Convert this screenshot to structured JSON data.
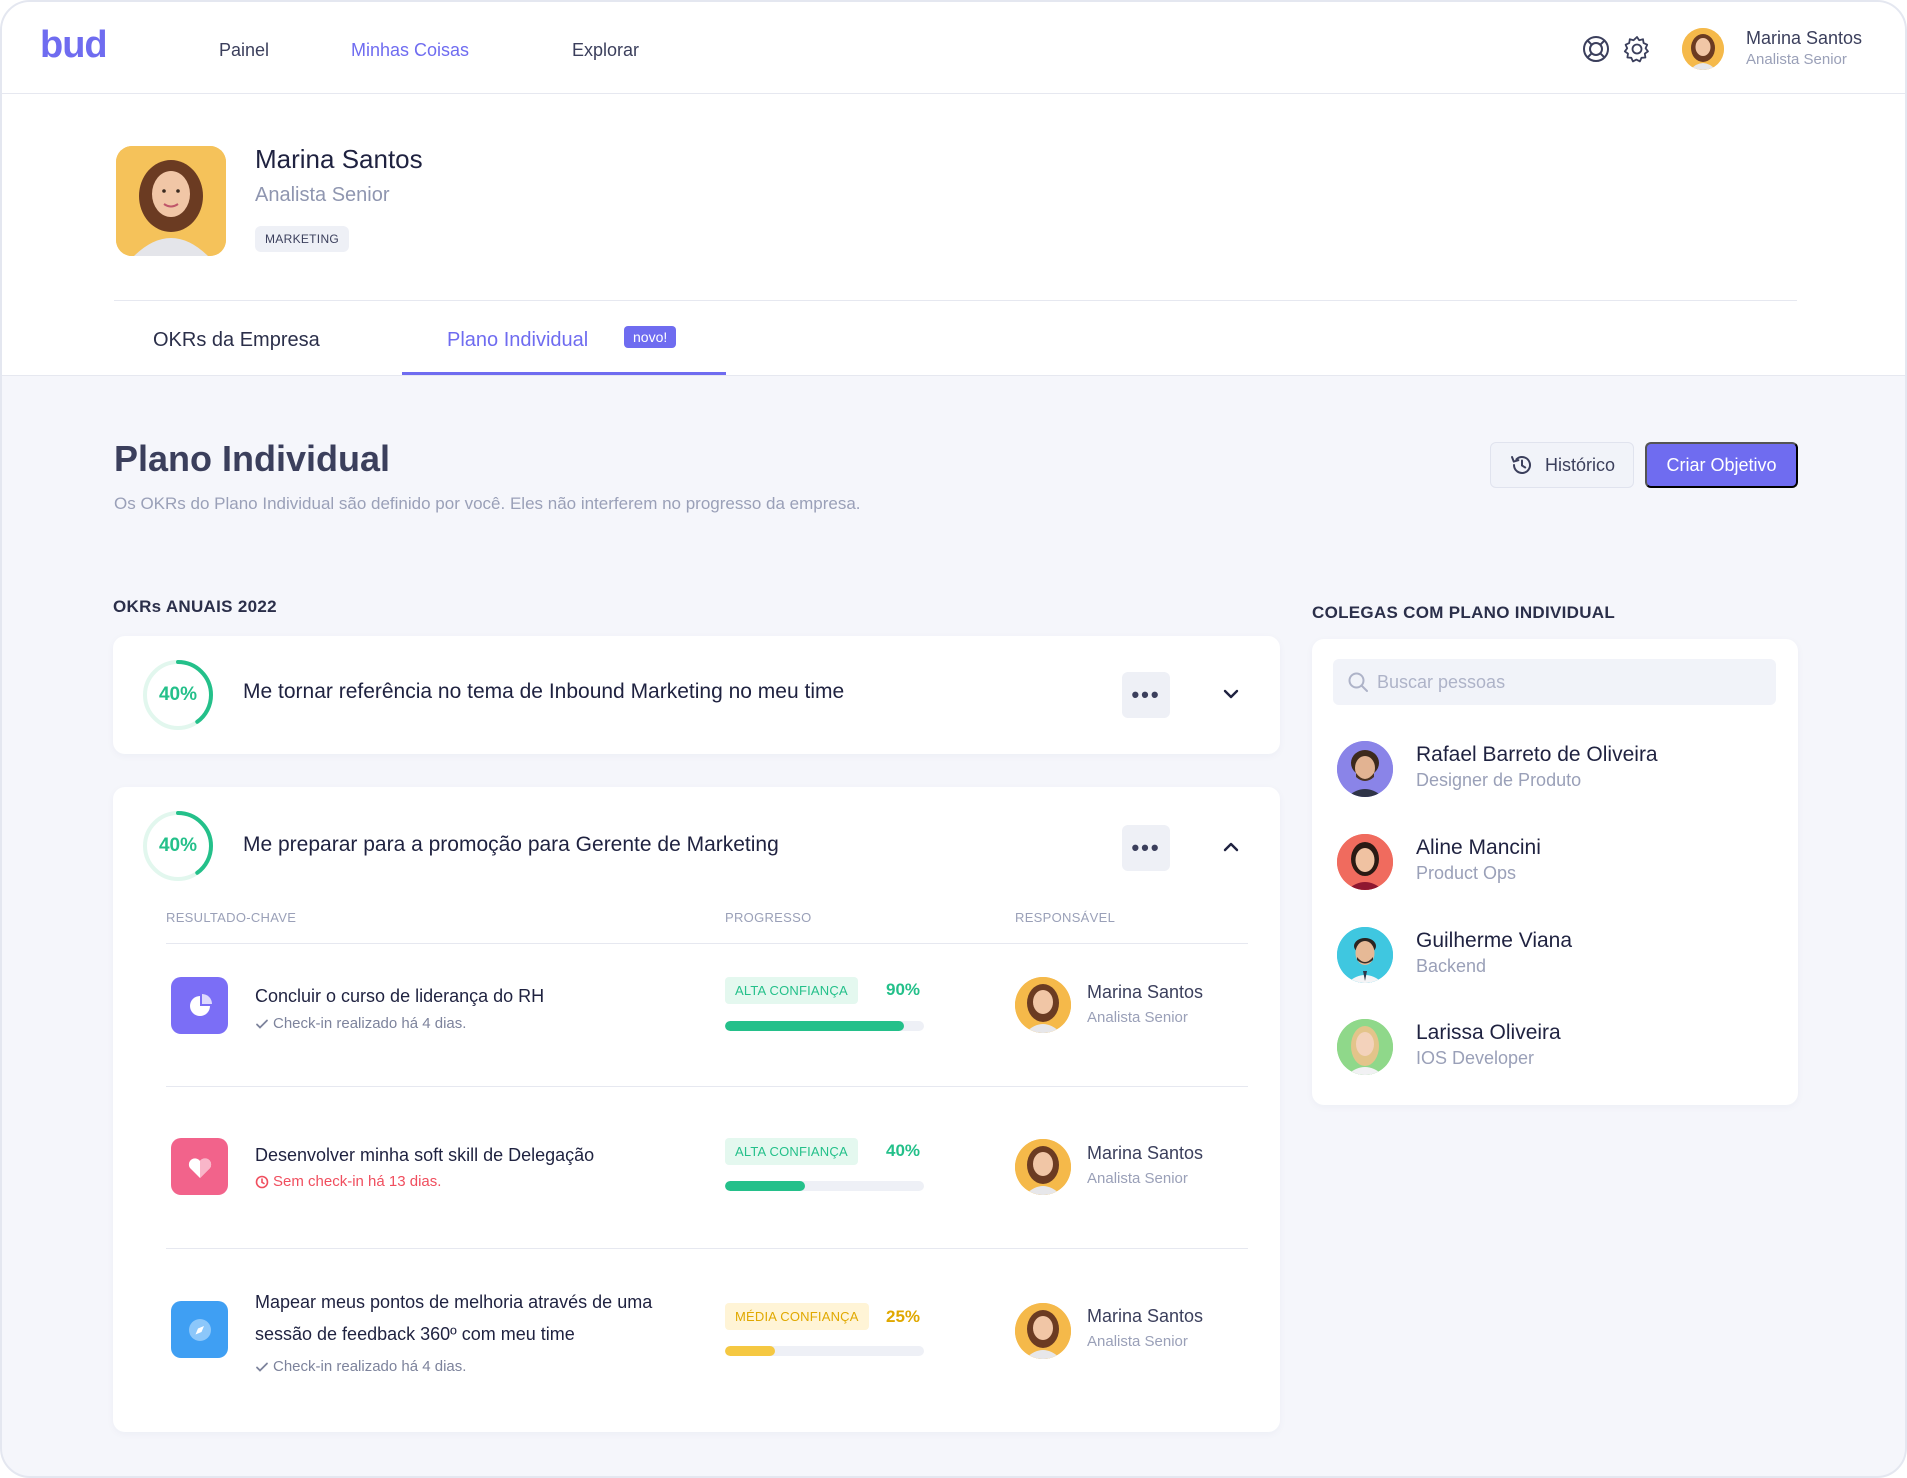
{
  "nav": {
    "logo": "bud",
    "links": [
      {
        "label": "Painel",
        "active": false
      },
      {
        "label": "Minhas Coisas",
        "active": true
      },
      {
        "label": "Explorar",
        "active": false
      }
    ],
    "icons": [
      "help-icon",
      "settings-icon"
    ],
    "user": {
      "name": "Marina Santos",
      "role": "Analista Senior"
    }
  },
  "profile": {
    "name": "Marina Santos",
    "role": "Analista Senior",
    "team_tag": "MARKETING",
    "tabs": [
      {
        "label": "OKRs da Empresa",
        "active": false
      },
      {
        "label": "Plano Individual",
        "active": true,
        "badge": "novo!"
      }
    ]
  },
  "page": {
    "title": "Plano Individual",
    "subtitle": "Os OKRs do Plano Individual são definido por você. Eles não interferem no progresso da empresa.",
    "history_button": "Histórico",
    "create_button": "Criar Objetivo"
  },
  "okrs": {
    "section_label": "OKRs ANUAIS 2022",
    "objectives": [
      {
        "progress_label": "40%",
        "progress": 0.4,
        "title": "Me tornar referência no tema de Inbound Marketing no meu time",
        "expanded": false
      },
      {
        "progress_label": "40%",
        "progress": 0.4,
        "title": "Me preparar para a promoção para Gerente de Marketing",
        "expanded": true
      }
    ],
    "kr_headers": {
      "result": "RESULTADO-CHAVE",
      "progress": "PROGRESSO",
      "owner": "RESPONSÁVEL"
    },
    "key_results": [
      {
        "title": "Concluir o curso de liderança do RH",
        "status": "Check-in realizado há 4 dias.",
        "status_type": "ok",
        "icon": "pie-chart-icon",
        "icon_color": "#7b6ef6",
        "confidence": "ALTA CONFIANÇA",
        "confidence_level": "high",
        "percent_label": "90%",
        "percent": 90,
        "owner": {
          "name": "Marina Santos",
          "role": "Analista Senior"
        }
      },
      {
        "title": "Desenvolver minha soft skill de Delegação",
        "status": "Sem check-in há 13 dias.",
        "status_type": "warn",
        "icon": "heart-icon",
        "icon_color": "#f2638b",
        "confidence": "ALTA CONFIANÇA",
        "confidence_level": "high",
        "percent_label": "40%",
        "percent": 40,
        "owner": {
          "name": "Marina Santos",
          "role": "Analista Senior"
        }
      },
      {
        "title": "Mapear meus pontos de melhoria através de uma sessão de feedback 360º com meu time",
        "status": "Check-in realizado há 4 dias.",
        "status_type": "ok",
        "icon": "compass-icon",
        "icon_color": "#3f9ff3",
        "confidence": "MÉDIA CONFIANÇA",
        "confidence_level": "mid",
        "percent_label": "25%",
        "percent": 25,
        "owner": {
          "name": "Marina Santos",
          "role": "Analista Senior"
        }
      }
    ]
  },
  "colleagues": {
    "section_label": "COLEGAS COM PLANO INDIVIDUAL",
    "search_placeholder": "Buscar pessoas",
    "people": [
      {
        "name": "Rafael Barreto de Oliveira",
        "role": "Designer de Produto",
        "avatar_bg": "#8a84e8"
      },
      {
        "name": "Aline Mancini",
        "role": "Product Ops",
        "avatar_bg": "#f06b5e"
      },
      {
        "name": "Guilherme Viana",
        "role": "Backend",
        "avatar_bg": "#3fc7e0"
      },
      {
        "name": "Larissa Oliveira",
        "role": "IOS Developer",
        "avatar_bg": "#8fd88a"
      }
    ]
  },
  "colors": {
    "accent": "#6f6cf0",
    "success": "#24c08a",
    "warning": "#f5c842",
    "danger": "#f04e5e"
  }
}
